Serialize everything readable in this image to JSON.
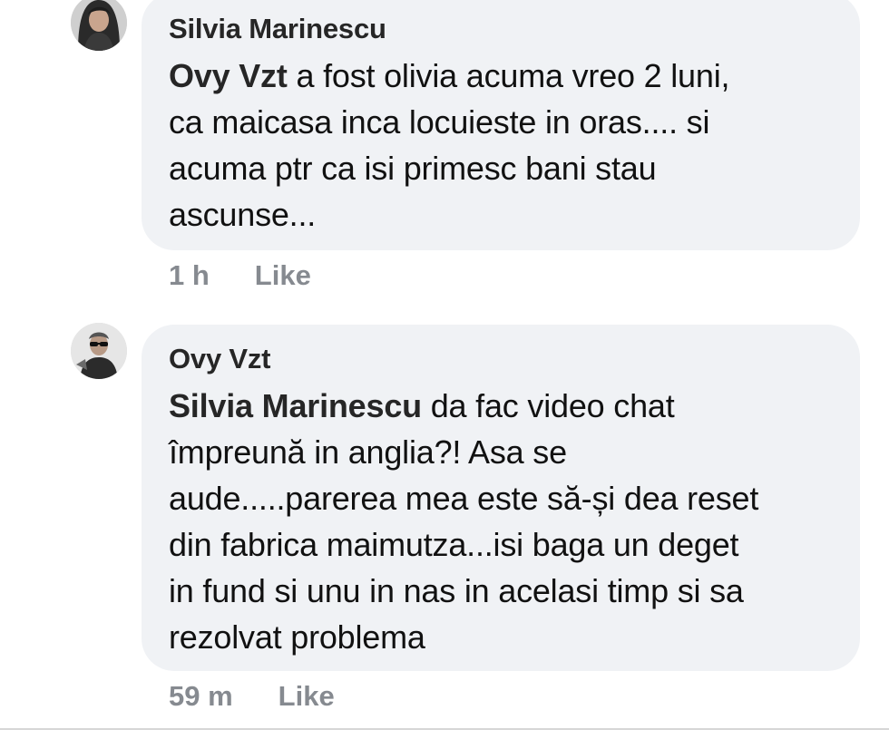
{
  "comments": [
    {
      "author": "Silvia Marinescu",
      "mention": "Ovy Vzt",
      "text_lines": [
        " a fost olivia acuma vreo 2 luni,",
        "ca maicasa inca locuieste in oras.... si",
        "acuma ptr ca isi primesc bani stau",
        "ascunse..."
      ],
      "time": "1 h",
      "like_label": "Like",
      "avatar_icon": "user-avatar-woman"
    },
    {
      "author": "Ovy Vzt",
      "mention": "Silvia Marinescu",
      "text_lines": [
        " da fac video chat",
        "împreună in anglia?! Asa se",
        "aude.....parerea mea este să-și dea reset",
        "din fabrica maimutza...isi baga un deget",
        "in fund si unu in nas in acelasi timp si sa",
        "rezolvat problema"
      ],
      "time": "59 m",
      "like_label": "Like",
      "avatar_icon": "user-avatar-man-sunglasses"
    }
  ],
  "colors": {
    "bubble_bg": "#f0f2f5",
    "meta_text": "#868a90",
    "author_text": "#262626"
  }
}
